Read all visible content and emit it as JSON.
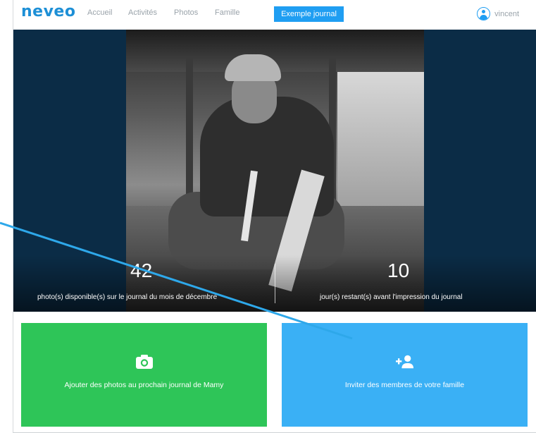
{
  "nav": {
    "logo": "neveo",
    "items": [
      {
        "label": "Accueil"
      },
      {
        "label": "Activités"
      },
      {
        "label": "Photos"
      },
      {
        "label": "Famille"
      }
    ],
    "active_item": "Exemple journal",
    "user_name": "vincent"
  },
  "hero": {
    "photos_count": "42",
    "photos_label": "photo(s) disponible(s) sur le journal du mois de décembre",
    "days_count": "10",
    "days_label": "jour(s) restant(s) avant l'impression du journal"
  },
  "cards": {
    "add_photos": {
      "label": "Ajouter des photos au prochain journal de Mamy",
      "icon": "camera-icon",
      "color": "#2ec558"
    },
    "invite": {
      "label": "Inviter des membres de votre famille",
      "icon": "add-user-icon",
      "color": "#3ab0f5"
    }
  },
  "colors": {
    "brand": "#1d8fd6",
    "nav_active": "#1f9ef2",
    "hero_bg": "#0b2c46",
    "annotation": "#2ea8ea"
  }
}
